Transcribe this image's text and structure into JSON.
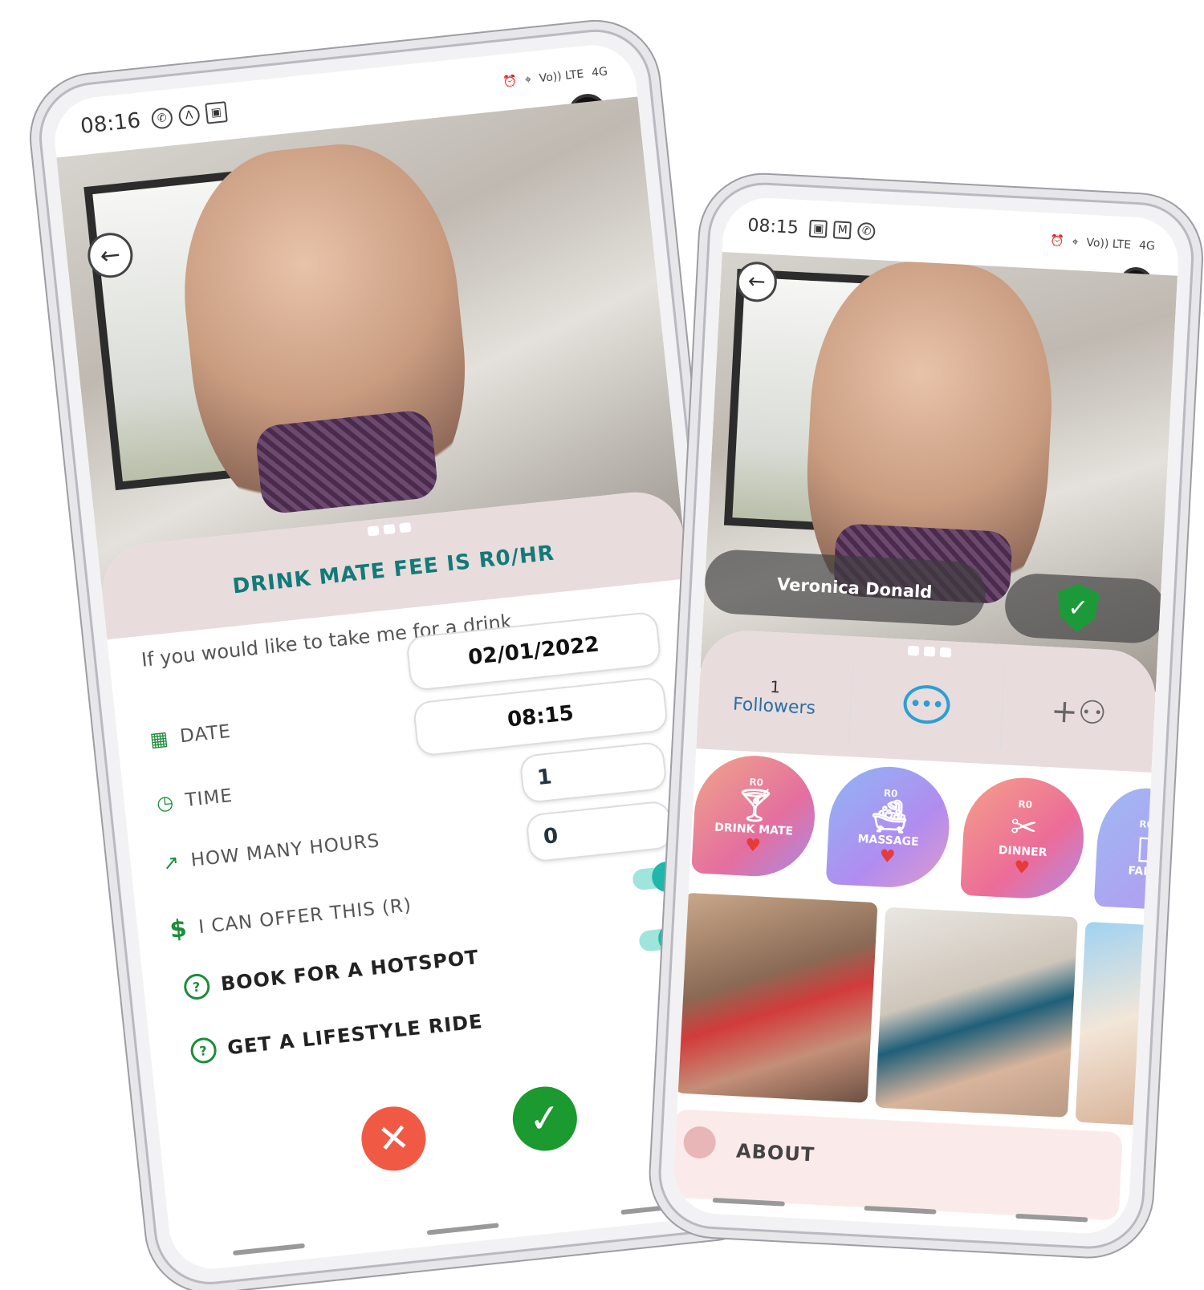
{
  "left_phone": {
    "status": {
      "time": "08:16",
      "icons": [
        "whatsapp-icon",
        "a-icon",
        "gallery-icon"
      ],
      "right": [
        "alarm-icon",
        "location-icon",
        "Vo)) LTE",
        "4G"
      ]
    },
    "back_icon": "arrow-left-icon",
    "sheet": {
      "title": "DRINK MATE FEE IS R0/HR",
      "prompt": "If you would like to take me for a drink",
      "date_label": "DATE",
      "date_value": "02/01/2022",
      "time_label": "TIME",
      "time_value": "08:15",
      "hours_label": "HOW MANY HOURS",
      "hours_value": "1",
      "offer_label": "I CAN OFFER THIS (R)",
      "offer_value": "0",
      "hotspot_label": "BOOK FOR A HOTSPOT",
      "ride_label": "GET A LIFESTYLE RIDE",
      "hotspot_on": true,
      "ride_on": true
    },
    "colors": {
      "accent": "#127a78",
      "decline": "#f05a45",
      "confirm": "#1a9a2f"
    }
  },
  "right_phone": {
    "status": {
      "time": "08:15",
      "icons": [
        "gallery-icon",
        "gmail-icon",
        "whatsapp-icon"
      ],
      "right": [
        "alarm-icon",
        "location-icon",
        "Vo)) LTE",
        "4G"
      ]
    },
    "profile_name": "Veronica Donald",
    "followers_count": "1",
    "followers_label": "Followers",
    "services": [
      {
        "price": "R0",
        "label": "DRINK MATE",
        "icon": "cocktail-icon",
        "color": "#e98aa6"
      },
      {
        "price": "R0",
        "label": "MASSAGE",
        "icon": "bathtub-icon",
        "color": "#a79af0"
      },
      {
        "price": "R0",
        "label": "DINNER",
        "icon": "cutlery-icon",
        "color": "#ee7f9c"
      },
      {
        "price": "R0",
        "label": "FAKE",
        "icon": "fake-icon",
        "color": "#b9a9f2"
      }
    ],
    "about_label": "ABOUT"
  }
}
